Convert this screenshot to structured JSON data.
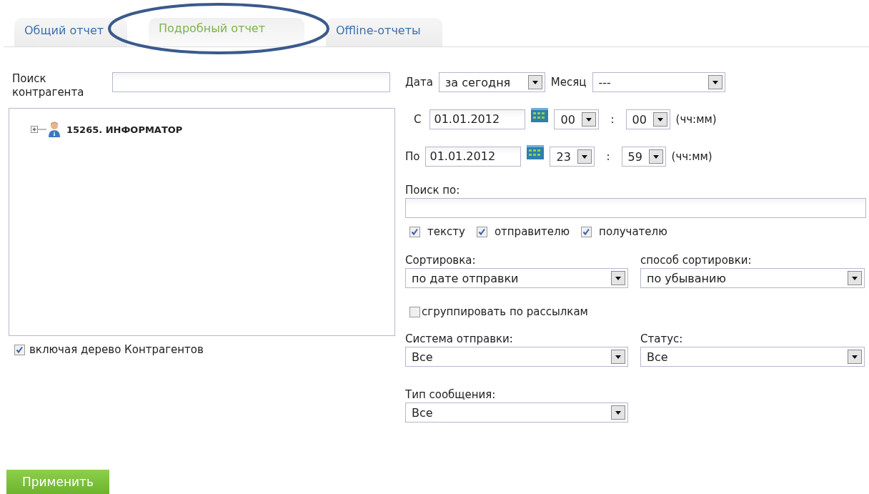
{
  "tabs": [
    {
      "label": "Общий отчет",
      "selected": false
    },
    {
      "label": "Подробный отчет",
      "selected": true
    },
    {
      "label": "Offline-отчеты",
      "selected": false
    }
  ],
  "counterparty_search": {
    "label": "Поиск контрагента"
  },
  "tree": [
    {
      "label": "15265. ИНФОРМАТОР",
      "expanded": false
    }
  ],
  "include_tree": {
    "label": "включая дерево Контрагентов",
    "checked": true
  },
  "date": {
    "label": "Дата",
    "value": "за сегодня"
  },
  "month": {
    "label": "Месяц",
    "value": "---"
  },
  "ranges": [
    {
      "label": "С",
      "date": "01.01.2012",
      "hour": "00",
      "minute": "00",
      "separator": ":",
      "hint": "(чч:мм)"
    },
    {
      "label": "По",
      "date": "01.01.2012",
      "hour": "23",
      "minute": "59",
      "separator": ":",
      "hint": "(чч:мм)"
    }
  ],
  "search_by": {
    "label": "Поиск по:",
    "options": [
      {
        "label": "тексту",
        "checked": true
      },
      {
        "label": "отправителю",
        "checked": true
      },
      {
        "label": "получателю",
        "checked": true
      }
    ]
  },
  "sort": {
    "label": "Сортировка:",
    "value": "по дате отправки"
  },
  "sort_order": {
    "label": "способ сортировки:",
    "value": "по убыванию"
  },
  "group_by_mailing": {
    "label": "сгруппировать по рассылкам",
    "checked": false
  },
  "send_system": {
    "label": "Система отправки:",
    "value": "Все"
  },
  "status": {
    "label": "Статус:",
    "value": "Все"
  },
  "message_type": {
    "label": "Тип сообщения:",
    "value": "Все"
  },
  "apply_button": "Применить"
}
